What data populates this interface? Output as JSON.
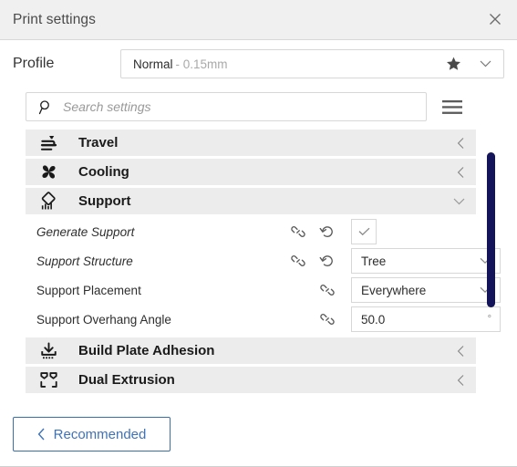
{
  "window": {
    "title": "Print settings",
    "close_icon": "close-icon"
  },
  "profile": {
    "label": "Profile",
    "value": "Normal",
    "detail": "- 0.15mm",
    "star_icon": "star-icon",
    "chevron_icon": "chevron-down-icon"
  },
  "search": {
    "placeholder": "Search settings",
    "value": "",
    "icon": "search-icon",
    "menu_icon": "hamburger-menu-icon"
  },
  "categories": [
    {
      "label": "Travel",
      "icon": "travel-icon",
      "expanded": false,
      "chevron": "chevron-left-icon",
      "settings": []
    },
    {
      "label": "Cooling",
      "icon": "cooling-fan-icon",
      "expanded": false,
      "chevron": "chevron-left-icon",
      "settings": []
    },
    {
      "label": "Support",
      "icon": "support-icon",
      "expanded": true,
      "chevron": "chevron-down-icon",
      "settings": [
        {
          "label": "Generate Support",
          "modified": true,
          "link_icon": "link-icon",
          "revert_icon": "revert-icon",
          "has_revert": true,
          "control": "checkbox",
          "checked": true,
          "value": "",
          "unit": ""
        },
        {
          "label": "Support Structure",
          "modified": true,
          "link_icon": "link-icon",
          "revert_icon": "revert-icon",
          "has_revert": true,
          "control": "dropdown",
          "checked": false,
          "value": "Tree",
          "unit": ""
        },
        {
          "label": "Support Placement",
          "modified": false,
          "link_icon": "link-icon",
          "revert_icon": "",
          "has_revert": false,
          "control": "dropdown",
          "checked": false,
          "value": "Everywhere",
          "unit": ""
        },
        {
          "label": "Support Overhang Angle",
          "modified": false,
          "link_icon": "link-icon",
          "revert_icon": "",
          "has_revert": false,
          "control": "text",
          "checked": false,
          "value": "50.0",
          "unit": "°"
        }
      ]
    },
    {
      "label": "Build Plate Adhesion",
      "icon": "build-plate-adhesion-icon",
      "expanded": false,
      "chevron": "chevron-left-icon",
      "settings": []
    },
    {
      "label": "Dual Extrusion",
      "icon": "dual-extrusion-icon",
      "expanded": false,
      "chevron": "chevron-left-icon",
      "settings": []
    }
  ],
  "scrollbar": {
    "name": "settings-scrollbar",
    "color": "#14145a"
  },
  "footer": {
    "recommended_label": "Recommended",
    "recommended_chevron": "chevron-left-icon",
    "accent_color": "#3f72b8"
  }
}
